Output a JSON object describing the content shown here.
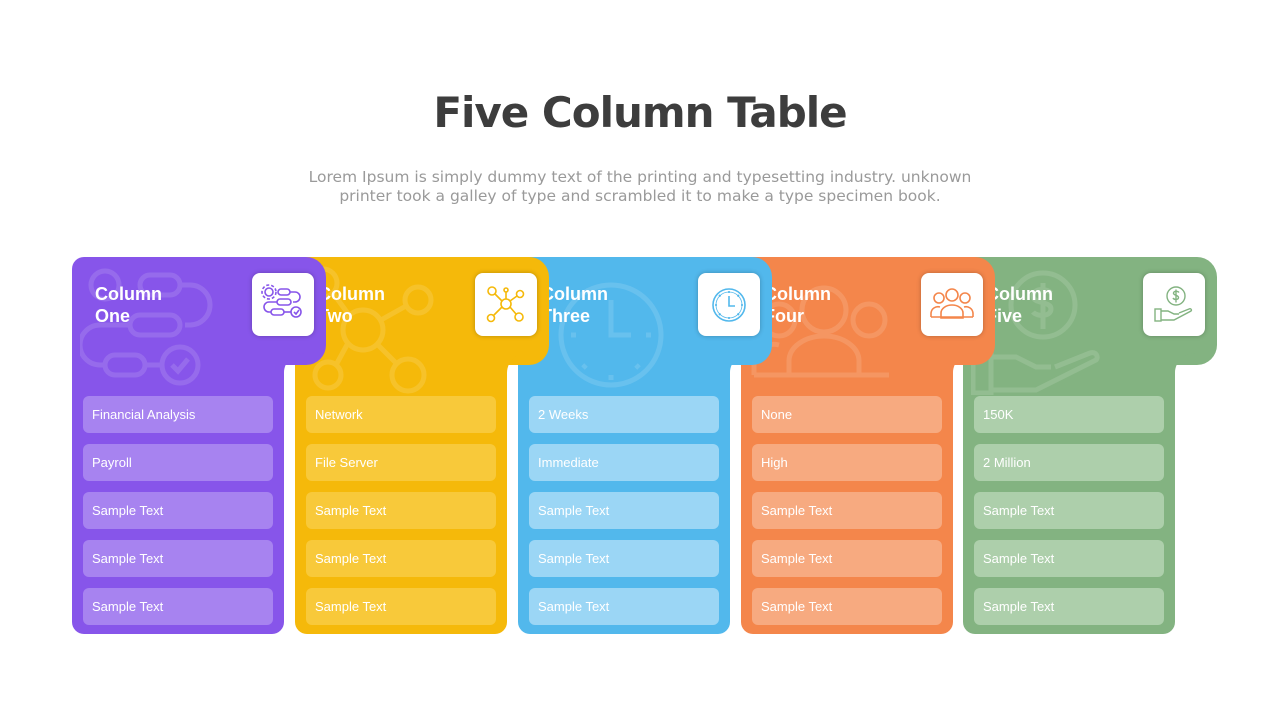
{
  "title": "Five Column Table",
  "subtitle_line1": "Lorem Ipsum is simply dummy text of the printing and typesetting industry. unknown",
  "subtitle_line2": "printer took a galley of type and scrambled it to make a type specimen book.",
  "columns": [
    {
      "line1": "Column",
      "line2": "One",
      "icon": "workflow-icon",
      "color": "#8755ea",
      "cell_color": "#a783f0",
      "cells": [
        "Financial Analysis",
        "Payroll",
        "Sample Text",
        "Sample Text",
        "Sample Text"
      ]
    },
    {
      "line1": "Column",
      "line2": "Two",
      "icon": "network-icon",
      "color": "#f5b90a",
      "cell_color": "#f8c93a",
      "cells": [
        "Network",
        "File Server",
        "Sample Text",
        "Sample Text",
        "Sample Text"
      ]
    },
    {
      "line1": "Column",
      "line2": "Three",
      "icon": "clock-icon",
      "color": "#52b8ec",
      "cell_color": "#9bd6f5",
      "cells": [
        "2 Weeks",
        "Immediate",
        "Sample Text",
        "Sample Text",
        "Sample Text"
      ]
    },
    {
      "line1": "Column",
      "line2": "Four",
      "icon": "team-icon",
      "color": "#f4864b",
      "cell_color": "#f7aa80",
      "cells": [
        "None",
        "High",
        "Sample Text",
        "Sample Text",
        "Sample Text"
      ]
    },
    {
      "line1": "Column",
      "line2": "Five",
      "icon": "money-hand-icon",
      "color": "#83b381",
      "cell_color": "#adcfab",
      "cells": [
        "150K",
        "2 Million",
        "Sample Text",
        "Sample Text",
        "Sample Text"
      ]
    }
  ]
}
